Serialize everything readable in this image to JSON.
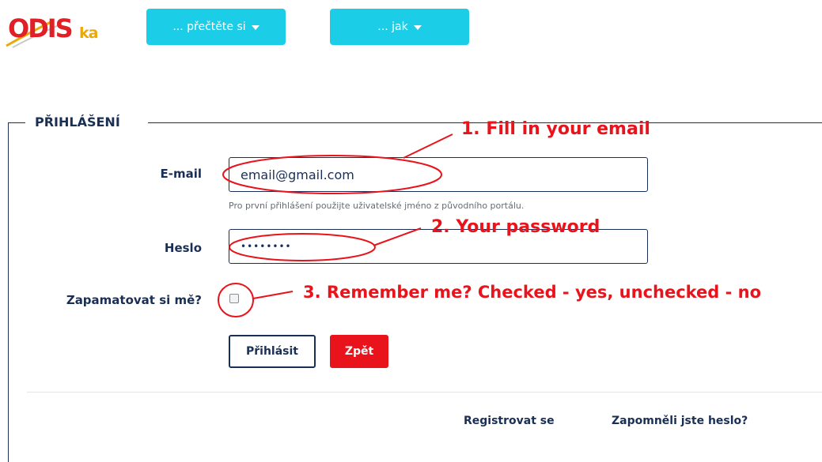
{
  "logo": {
    "main_text": "ODIS",
    "suffix_text": "ka"
  },
  "nav": {
    "read_label": "... přečtěte si",
    "how_label": "... jak"
  },
  "form": {
    "legend": "PŘIHLÁŠENÍ",
    "email_label": "E-mail",
    "email_value": "email@gmail.com",
    "email_hint": "Pro první přihlášení použijte uživatelské jméno z původního portálu.",
    "password_label": "Heslo",
    "password_value": "••••••••",
    "remember_label": "Zapamatovat si mě?",
    "remember_checked": false,
    "login_button": "Přihlásit",
    "back_button": "Zpět",
    "register_link": "Registrovat se",
    "forgot_link": "Zapomněli jste heslo?"
  },
  "annotations": {
    "step1": "1. Fill in your email",
    "step2": "2. Your password",
    "step3": "3. Remember me? Checked - yes, unchecked - no",
    "color": "#e8131b"
  },
  "colors": {
    "navy": "#1a2f55",
    "nav_cyan": "#1ccde8",
    "back_red": "#e8131b",
    "logo_red": "#e01f26",
    "logo_gold": "#e8a90c"
  }
}
